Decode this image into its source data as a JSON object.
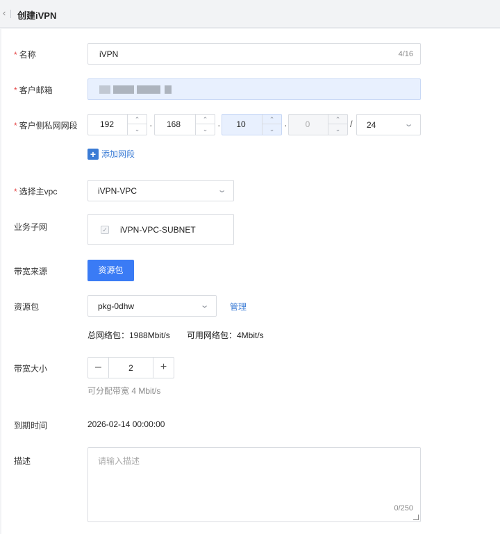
{
  "header": {
    "back_icon": "chevron-left-icon",
    "title": "创建iVPN"
  },
  "form": {
    "name": {
      "label": "名称",
      "value": "iVPN",
      "count": "4/16"
    },
    "email": {
      "label": "客户邮箱"
    },
    "cidr": {
      "label": "客户侧私网网段",
      "octets": [
        "192",
        "168",
        "10",
        "0"
      ],
      "mask": "24",
      "add_label": "添加网段"
    },
    "vpc": {
      "label": "选择主vpc",
      "value": "iVPN-VPC"
    },
    "subnet": {
      "label": "业务子网",
      "value": "iVPN-VPC-SUBNET"
    },
    "bandwidth_source": {
      "label": "带宽来源",
      "button": "资源包"
    },
    "package": {
      "label": "资源包",
      "value": "pkg-0dhw",
      "manage": "管理",
      "total": "总网络包：1988Mbit/s",
      "available": "可用网络包：4Mbit/s"
    },
    "bandwidth_size": {
      "label": "带宽大小",
      "value": "2",
      "hint": "可分配带宽 4 Mbit/s"
    },
    "expire": {
      "label": "到期时间",
      "value": "2026-02-14 00:00:00"
    },
    "description": {
      "label": "描述",
      "placeholder": "请输入描述",
      "count": "0/250"
    }
  },
  "colors": {
    "primary": "#3a7bf5",
    "required": "#e54545",
    "link": "#3a7bd5"
  }
}
